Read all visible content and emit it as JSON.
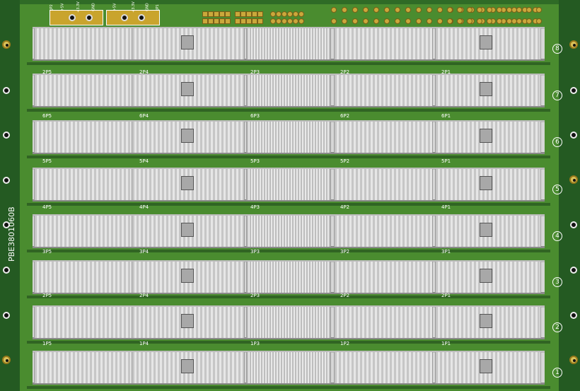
{
  "board": {
    "part_number": "PBE3801060B",
    "slots": [
      {
        "num": "8",
        "labels": [
          "2P5",
          "2P4",
          "2P3",
          "2P2",
          "2P1"
        ]
      },
      {
        "num": "7",
        "labels": [
          "6P5",
          "6P4",
          "6P3",
          "6P2",
          "6P1"
        ]
      },
      {
        "num": "6",
        "labels": [
          "5P5",
          "5P4",
          "5P3",
          "5P2",
          "5P1"
        ]
      },
      {
        "num": "5",
        "labels": [
          "4P5",
          "4P4",
          "4P3",
          "4P2",
          "4P1"
        ]
      },
      {
        "num": "4",
        "labels": [
          "3P5",
          "3P4",
          "3P3",
          "3P2",
          "3P1"
        ]
      },
      {
        "num": "3",
        "labels": [
          "2P5",
          "2P4",
          "2P3",
          "2P2",
          "2P1"
        ]
      },
      {
        "num": "2",
        "labels": [
          "1P5",
          "1P4",
          "1P3",
          "1P2",
          "1P1"
        ]
      },
      {
        "num": "1",
        "labels": [
          "",
          "",
          "",
          "",
          ""
        ]
      }
    ],
    "power_labels": [
      "JP2",
      "+5V",
      "+3.3V",
      "GND",
      "+5V",
      "+3.3V",
      "GND",
      "JP1"
    ]
  }
}
